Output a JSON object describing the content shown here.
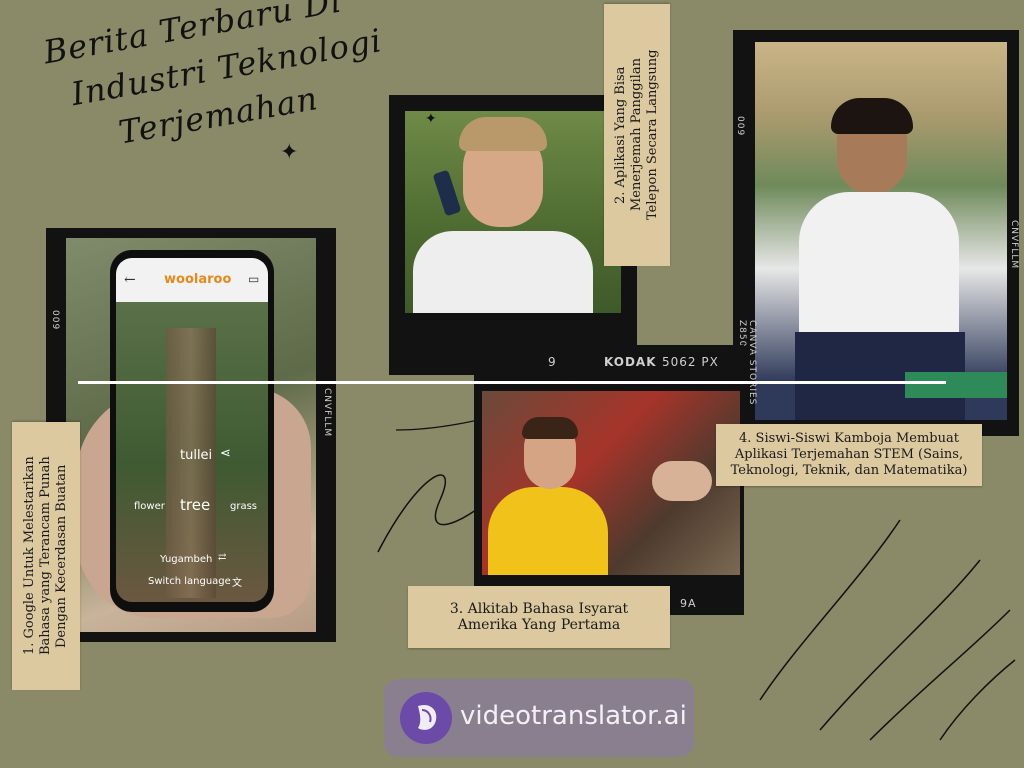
{
  "title": {
    "line1": "Berita Terbaru Di",
    "line2": "Industri Teknologi",
    "line3": "Terjemahan"
  },
  "cards": [
    {
      "number": "1.",
      "text_lines": [
        "1. Google Untuk Melestarikan",
        "Bahasa yang Terancam Punah",
        "Dengan Kecerdasan Buatan"
      ]
    },
    {
      "text_lines": [
        "2. Aplikasi Yang Bisa",
        "Menerjemah Panggilan",
        "Telepon Secara Langsung"
      ]
    },
    {
      "text_lines": [
        "3. Alkitab Bahasa Isyarat",
        "Amerika Yang Pertama"
      ]
    },
    {
      "text_lines": [
        "4. Siswi-Siswi Kamboja Membuat",
        "Aplikasi Terjemahan STEM (Sains,",
        "Teknologi, Teknik, dan Matematika)"
      ]
    }
  ],
  "phone_app": {
    "app_name": "woolaroo",
    "word_top": "tullei",
    "word_main": "tree",
    "word_left": "flower",
    "word_right": "grass",
    "language": "Yugambeh",
    "switch_label": "Switch language"
  },
  "film_marks": {
    "kodak_num": "9",
    "kodak_label": "KODAK",
    "kodak_code": "5062 PX",
    "frame_9a": "9A",
    "side_009": "009",
    "cnvfllm": "CNVFLLM",
    "canva_stories": "CANVA STORIES Z850"
  },
  "brand": {
    "name": "videotranslator.ai"
  },
  "colors": {
    "background": "#8a8a68",
    "tape": "#dcc9a0",
    "film": "#121212",
    "brand_box": "#8a7f8f",
    "brand_logo": "#6c4aa8"
  }
}
